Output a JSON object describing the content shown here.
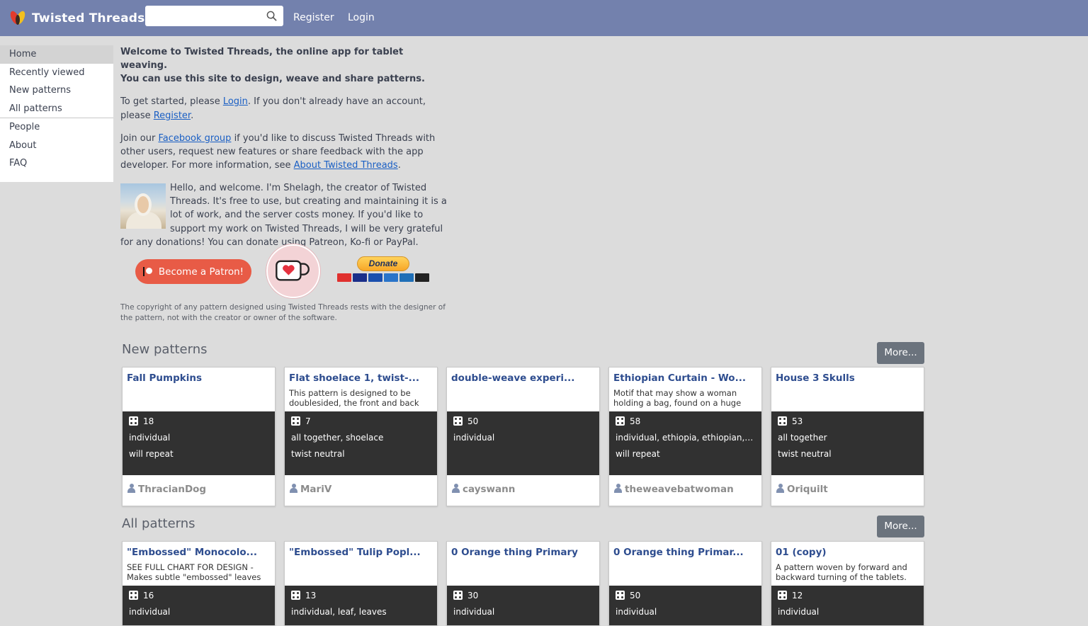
{
  "header": {
    "app_name": "Twisted Threads",
    "search_placeholder": "",
    "links": [
      "Register",
      "Login"
    ]
  },
  "sidebar": {
    "items": [
      {
        "label": "Home",
        "active": true
      },
      {
        "label": "Recently viewed"
      },
      {
        "label": "New patterns"
      },
      {
        "label": "All patterns"
      },
      {
        "label": "People"
      },
      {
        "label": "About"
      },
      {
        "label": "FAQ"
      }
    ]
  },
  "intro": {
    "lead_line1": "Welcome to Twisted Threads, the online app for tablet weaving.",
    "lead_line2": "You can use this site to design, weave and share patterns.",
    "start_pre": "To get started, please ",
    "start_login": "Login",
    "start_mid": ". If you don't already have an account, please ",
    "start_register": "Register",
    "start_post": ".",
    "join_pre": "Join our ",
    "join_facebook": "Facebook group",
    "join_mid": " if you'd like to discuss Twisted Threads with other users, request new features or share feedback with the app developer. For more information, see ",
    "join_about": "About Twisted Threads",
    "join_post": ".",
    "hello": "Hello, and welcome. I'm Shelagh, the creator of Twisted Threads. It's free to use, but creating and maintaining it is a lot of work, and the server costs money. If you'd like to support my work on Twisted Threads, I will be very grateful for any donations! You can donate using Patreon, Ko-fi or PayPal."
  },
  "donate": {
    "patreon_label": "Become a Patron!",
    "paypal_label": "Donate",
    "card_colors": [
      "#e0302e",
      "#1a2f8a",
      "#1a4fae",
      "#2a74c9",
      "#1f6fb7",
      "#222222"
    ]
  },
  "copyright": "The copyright of any pattern designed using Twisted Threads rests with the designer of the pattern, not with the creator or owner of the software.",
  "new_patterns": {
    "title": "New patterns",
    "more_label": "More...",
    "cards": [
      {
        "title": "Fall Pumpkins",
        "desc": "",
        "tablets": "18",
        "line2": "individual",
        "line3": "will repeat",
        "author": "ThracianDog"
      },
      {
        "title": "Flat shoelace 1, twist-...",
        "desc": "This pattern is designed to be doublesided, the front and back are",
        "tablets": "7",
        "line2": "all together, shoelace",
        "line3": "twist neutral",
        "author": "MariV"
      },
      {
        "title": "double-weave experi...",
        "desc": "",
        "tablets": "50",
        "line2": "individual",
        "line3": "",
        "author": "cayswann"
      },
      {
        "title": "Ethiopian Curtain - Wo...",
        "desc": "Motif that may show a woman holding a bag, found on a huge",
        "tablets": "58",
        "line2": "individual, ethiopia, ethiopian, a...",
        "line3": "will repeat",
        "author": "theweavebatwoman"
      },
      {
        "title": "House 3 Skulls",
        "desc": "",
        "tablets": "53",
        "line2": "all together",
        "line3": "twist neutral",
        "author": "Oriquilt"
      }
    ]
  },
  "all_patterns": {
    "title": "All patterns",
    "more_label": "More...",
    "cards": [
      {
        "title": "\"Embossed\" Monocolo...",
        "desc": "SEE FULL CHART FOR DESIGN - Makes subtle \"embossed\" leaves by",
        "tablets": "16",
        "line2": "individual"
      },
      {
        "title": "\"Embossed\" Tulip Popl...",
        "desc": "",
        "tablets": "13",
        "line2": "individual, leaf, leaves"
      },
      {
        "title": "0 Orange thing Primary",
        "desc": "",
        "tablets": "30",
        "line2": "individual"
      },
      {
        "title": "0 Orange thing Primar...",
        "desc": "",
        "tablets": "50",
        "line2": "individual"
      },
      {
        "title": "01 (copy)",
        "desc": "A pattern woven by forward and backward turning of the tablets.",
        "tablets": "12",
        "line2": "individual"
      }
    ]
  }
}
